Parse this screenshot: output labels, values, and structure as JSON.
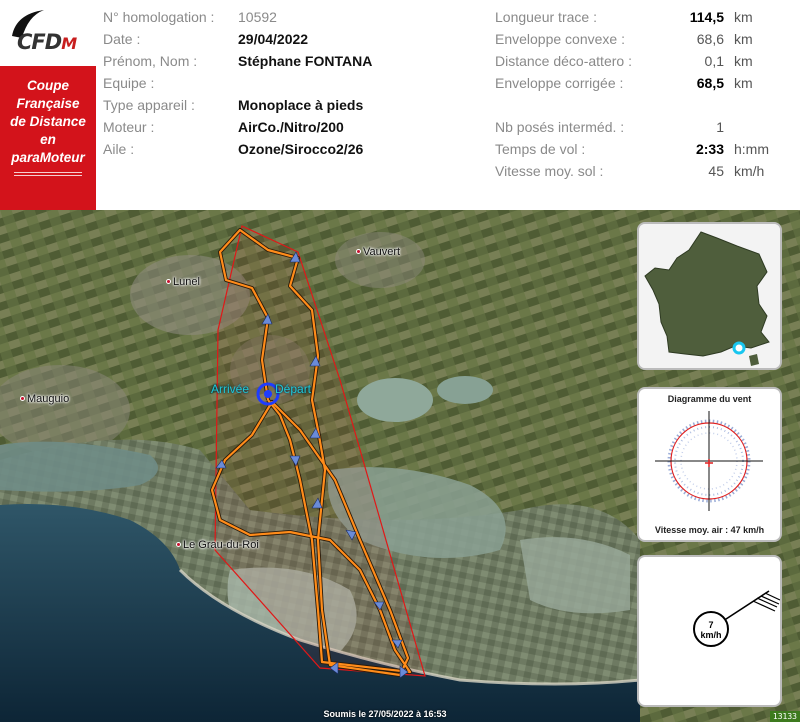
{
  "logo": {
    "text": "CFD",
    "accent": "M"
  },
  "cup_title": [
    "Coupe",
    "Française",
    "de Distance",
    "en",
    "paraMoteur"
  ],
  "pilot_info": [
    {
      "label": "N° homologation :",
      "value": "10592",
      "bold": false
    },
    {
      "label": "Date :",
      "value": "29/04/2022",
      "bold": true
    },
    {
      "label": "Prénom, Nom :",
      "value": "Stéphane FONTANA",
      "bold": true
    },
    {
      "label": "Equipe :",
      "value": "",
      "bold": true
    },
    {
      "label": "Type appareil :",
      "value": "Monoplace à pieds",
      "bold": true
    },
    {
      "label": "Moteur :",
      "value": "AirCo./Nitro/200",
      "bold": true
    },
    {
      "label": "Aile :",
      "value": "Ozone/Sirocco2/26",
      "bold": true
    }
  ],
  "flight_stats": {
    "longueur": {
      "label": "Longueur trace :",
      "value": "114,5",
      "unit": "km"
    },
    "convexe": {
      "label": "Enveloppe convexe :",
      "value": "68,6",
      "unit": "km"
    },
    "deco_attero": {
      "label": "Distance déco-attero :",
      "value": "0,1",
      "unit": "km"
    },
    "corrigee": {
      "label": "Enveloppe corrigée :",
      "value": "68,5",
      "unit": "km"
    },
    "poses": {
      "label": "Nb posés interméd. :",
      "value": "1",
      "unit": ""
    },
    "temps": {
      "label": "Temps de vol :",
      "value": "2:33",
      "unit": "h:mm"
    },
    "vitesse": {
      "label": "Vitesse moy. sol :",
      "value": "45",
      "unit": "km/h"
    }
  },
  "map": {
    "towns": {
      "vauvert": "Vauvert",
      "lunel": "Lunel",
      "mauguio": "Mauguio",
      "grau": "Le Grau-du-Roi"
    },
    "arrivee": "Arrivée",
    "depart": "Départ",
    "track_color": "#ff8c1a",
    "hull_color": "#e01818",
    "marker_color": "#1e3cff"
  },
  "wind_panel": {
    "title": "Diagramme du vent",
    "caption": "Vitesse moy. air : 47 km/h"
  },
  "wind_speed": {
    "value": "7",
    "unit": "km/h"
  },
  "footer": "Soumis le 27/05/2022 à 16:53",
  "tile_badge": "13133"
}
